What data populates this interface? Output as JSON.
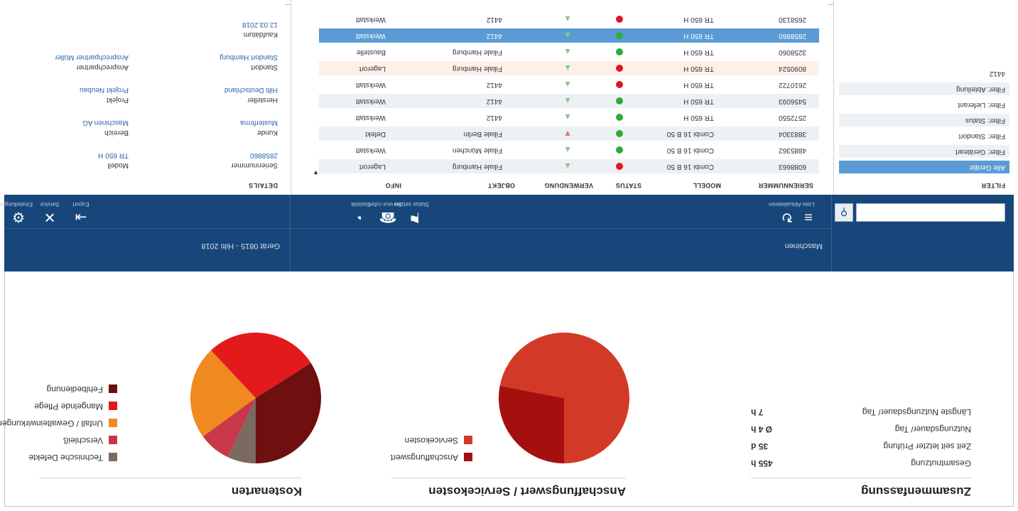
{
  "summary": {
    "title": "Zusammenfassung",
    "rows": [
      {
        "label": "Gesamtnutzung",
        "value": "455 h"
      },
      {
        "label": "Zeit seit letzter Prüfung",
        "value": "35 d"
      },
      {
        "label": "Nutzungsdauer/ Tag",
        "value": "Ø 4 h"
      },
      {
        "label": "Längste Nutzungsdauer/ Tag",
        "value": "7 h"
      }
    ]
  },
  "acquisition": {
    "title": "Anschaffungswert / Servicekosten",
    "legend": [
      {
        "label": "Anschaffungswert",
        "color": "#a5100e"
      },
      {
        "label": "Servicekosten",
        "color": "#d23a27"
      }
    ],
    "chart_data": {
      "type": "pie",
      "labels": [
        "Anschaffungswert",
        "Servicekosten"
      ],
      "values": [
        28,
        72
      ]
    }
  },
  "costs": {
    "title": "Kostenarten",
    "legend": [
      {
        "label": "Technische Defekte",
        "color": "#7a6a60"
      },
      {
        "label": "Verschleiß",
        "color": "#c9374a"
      },
      {
        "label": "Unfall / Gewalteinwirkungen",
        "color": "#f0891f"
      },
      {
        "label": "Mangelnde Pflege",
        "color": "#e31a1c"
      },
      {
        "label": "Fehlbedienung",
        "color": "#6e1010"
      }
    ],
    "chart_data": {
      "type": "pie",
      "labels": [
        "Technische Defekte",
        "Verschleiß",
        "Unfall / Gewalteinwirkungen",
        "Mangelnde Pflege",
        "Fehlbedienung"
      ],
      "values": [
        7,
        8,
        23,
        28,
        34
      ]
    }
  },
  "toolbar": {
    "left_title": "Maschinen",
    "right_title": "Gerät 0815 - Hilti 2018",
    "search": {
      "value": "",
      "placeholder": ""
    },
    "left_tools": [
      {
        "icon": "list-icon",
        "label": "Liste"
      },
      {
        "icon": "refresh-icon",
        "label": "Aktualisieren"
      }
    ],
    "mid_tools": [
      {
        "icon": "flag-icon",
        "label": "Status setzen"
      },
      {
        "icon": "phone-icon",
        "label": "Service rufen"
      },
      {
        "icon": "chart-icon",
        "label": "Statistik"
      }
    ],
    "right_tools": [
      {
        "icon": "export-icon",
        "label": "Export"
      },
      {
        "icon": "tools-icon",
        "label": "Service"
      },
      {
        "icon": "gear-icon",
        "label": "Einstellungen"
      }
    ]
  },
  "filter": {
    "header": "FILTER",
    "items": [
      "Alle Geräte",
      "Filter: Geräteart",
      "Filter: Standort",
      "Filter: Status",
      "Filter: Lieferant",
      "Filter: Abteilung",
      "4412"
    ],
    "selected_index": 0
  },
  "table": {
    "headers": [
      "SERIENNUMMER",
      "MODELL",
      "STATUS",
      "VERWENDUNG",
      "OBJEKT",
      "INFO"
    ],
    "rows": [
      {
        "serial": "6088663",
        "model": "Combi 16 B 50",
        "status": "red",
        "trend": "up",
        "object": "Filiale Hamburg",
        "info": "Lagerort"
      },
      {
        "serial": "4885362",
        "model": "Combi 16 B 50",
        "status": "green",
        "trend": "up",
        "object": "Filiale München",
        "info": "Werkstatt"
      },
      {
        "serial": "3883304",
        "model": "Combi 16 B 50",
        "status": "green",
        "trend": "down",
        "object": "Filiale Berlin",
        "info": "Defekt"
      },
      {
        "serial": "2572550",
        "model": "TR 650 H",
        "status": "green",
        "trend": "up",
        "object": "4412",
        "info": "Werkstatt"
      },
      {
        "serial": "5456093",
        "model": "TR 650 H",
        "status": "green",
        "trend": "up",
        "object": "4412",
        "info": "Werkstatt"
      },
      {
        "serial": "2610722",
        "model": "TR 650 H",
        "status": "red",
        "trend": "up",
        "object": "4412",
        "info": "Werkstatt"
      },
      {
        "serial": "8090524",
        "model": "TR 650 H",
        "status": "red",
        "trend": "up",
        "object": "Filiale Hamburg",
        "info": "Lagerort"
      },
      {
        "serial": "3258060",
        "model": "TR 650 H",
        "status": "green",
        "trend": "up",
        "object": "Filiale Hamburg",
        "info": "Baustelle"
      },
      {
        "serial": "2858860",
        "model": "TR 650 H",
        "status": "green",
        "trend": "up",
        "object": "4412",
        "info": "Werkstatt"
      },
      {
        "serial": "2658130",
        "model": "TR 650 H",
        "status": "red",
        "trend": "up",
        "object": "4412",
        "info": "Werkstatt"
      }
    ],
    "selected_index": 8,
    "highlighted_index": 6
  },
  "details": {
    "header": "DETAILS",
    "fields": [
      {
        "label": "Seriennummer",
        "value": "2858860",
        "col": 0,
        "row": 0
      },
      {
        "label": "Modell",
        "value": "TR 650 H",
        "col": 1,
        "row": 0
      },
      {
        "label": "Kunde",
        "value": "Musterfirma",
        "col": 0,
        "row": 1
      },
      {
        "label": "Bereich",
        "value": "Maschinen AG",
        "col": 1,
        "row": 1
      },
      {
        "label": "Hersteller",
        "value": "Hilti Deutschland",
        "col": 0,
        "row": 2
      },
      {
        "label": "Projekt",
        "value": "Projekt Neubau",
        "col": 1,
        "row": 2
      },
      {
        "label": "Standort",
        "value": "Standort Hamburg",
        "col": 0,
        "row": 3
      },
      {
        "label": "Ansprechpartner",
        "value": "Ansprechpartner Müller",
        "col": 1,
        "row": 3
      },
      {
        "label": "Kaufdatum",
        "value": "12.03.2018",
        "col": 0,
        "row": 4
      }
    ]
  }
}
